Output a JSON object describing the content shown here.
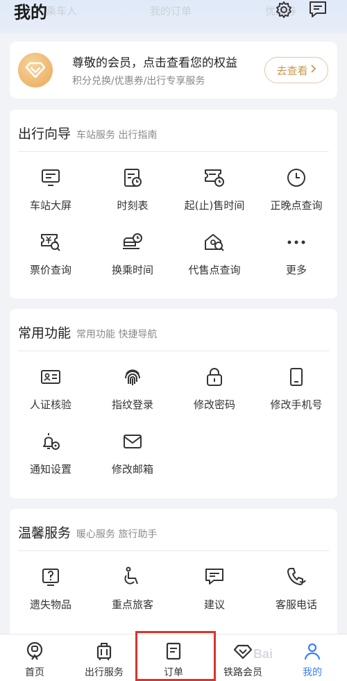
{
  "header": {
    "title": "我的",
    "faded_links": [
      "乘车人",
      "我的订单",
      "优惠券"
    ],
    "settings_icon": "gear-icon",
    "message_icon": "message-icon"
  },
  "member": {
    "title": "尊敬的会员，点击查看您的权益",
    "subtitle": "积分兑换/优惠券/出行专享服务",
    "button": "去查看"
  },
  "sections": [
    {
      "title": "出行向导",
      "subtitle": "车站服务 出行指南",
      "items": [
        {
          "label": "车站大屏",
          "icon": "screen-icon"
        },
        {
          "label": "时刻表",
          "icon": "timetable-icon"
        },
        {
          "label": "起(止)售时间",
          "icon": "ticket-clock-icon"
        },
        {
          "label": "正晚点查询",
          "icon": "clock-icon"
        },
        {
          "label": "票价查询",
          "icon": "price-search-icon"
        },
        {
          "label": "换乘时间",
          "icon": "transfer-icon"
        },
        {
          "label": "代售点查询",
          "icon": "agency-search-icon"
        },
        {
          "label": "更多",
          "icon": "more-icon"
        }
      ]
    },
    {
      "title": "常用功能",
      "subtitle": "常用功能 快捷导航",
      "items": [
        {
          "label": "人证核验",
          "icon": "id-card-icon"
        },
        {
          "label": "指纹登录",
          "icon": "fingerprint-icon"
        },
        {
          "label": "修改密码",
          "icon": "lock-icon"
        },
        {
          "label": "修改手机号",
          "icon": "phone-icon"
        },
        {
          "label": "通知设置",
          "icon": "bell-settings-icon"
        },
        {
          "label": "修改邮箱",
          "icon": "mail-icon"
        }
      ]
    },
    {
      "title": "温馨服务",
      "subtitle": "暖心服务 旅行助手",
      "items": [
        {
          "label": "遗失物品",
          "icon": "lost-item-icon"
        },
        {
          "label": "重点旅客",
          "icon": "wheelchair-icon"
        },
        {
          "label": "建议",
          "icon": "feedback-icon"
        },
        {
          "label": "客服电话",
          "icon": "phone-call-icon"
        }
      ]
    }
  ],
  "tabbar": {
    "items": [
      {
        "label": "首页",
        "icon": "home-train-icon"
      },
      {
        "label": "出行服务",
        "icon": "luggage-icon"
      },
      {
        "label": "订单",
        "icon": "order-icon"
      },
      {
        "label": "铁路会员",
        "icon": "diamond-icon"
      },
      {
        "label": "我的",
        "icon": "user-icon"
      }
    ],
    "active_index": 4
  },
  "colors": {
    "accent": "#3b7ff0",
    "gold": "#c9964d",
    "highlight": "#d9342e",
    "background": "#f2f3f6"
  },
  "watermark": "Bai"
}
